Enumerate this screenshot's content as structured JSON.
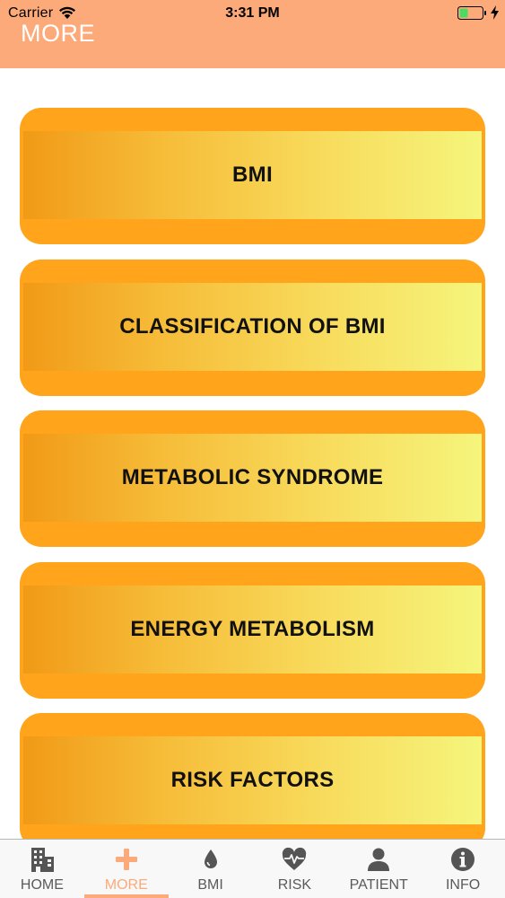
{
  "status_bar": {
    "carrier": "Carrier",
    "time": "3:31 PM"
  },
  "header": {
    "title": "MORE",
    "background": "#FCAA7A"
  },
  "menu": {
    "items": [
      {
        "label": "BMI"
      },
      {
        "label": "CLASSIFICATION OF BMI"
      },
      {
        "label": "METABOLIC SYNDROME"
      },
      {
        "label": "ENERGY METABOLISM"
      },
      {
        "label": "RISK FACTORS"
      }
    ]
  },
  "tab_bar": {
    "active": "MORE",
    "accent": "#FCAA7A",
    "tabs": [
      {
        "label": "HOME",
        "icon": "building-icon"
      },
      {
        "label": "MORE",
        "icon": "plus-icon"
      },
      {
        "label": "BMI",
        "icon": "drop-icon"
      },
      {
        "label": "RISK",
        "icon": "heart-pulse-icon"
      },
      {
        "label": "PATIENT",
        "icon": "person-icon"
      },
      {
        "label": "INFO",
        "icon": "info-icon"
      }
    ]
  }
}
